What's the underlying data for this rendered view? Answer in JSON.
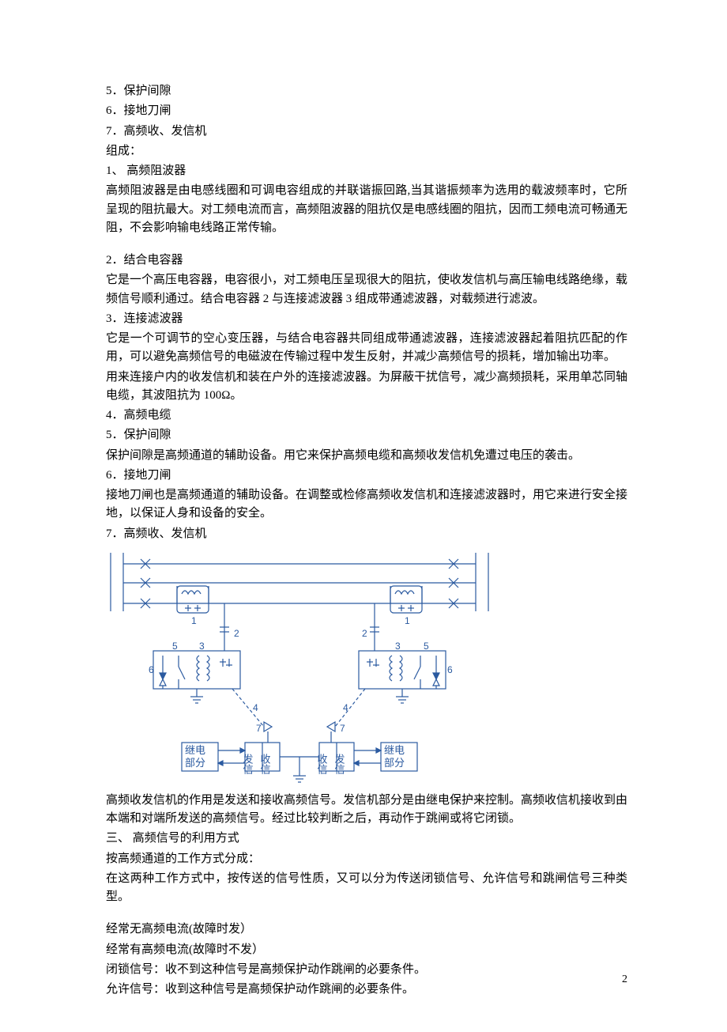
{
  "lines": {
    "l1": "5．保护间隙",
    "l2": "6．接地刀闸",
    "l3": "7．高频收、发信机",
    "l4": "组成：",
    "l5": "1、 高频阻波器",
    "l6": "高频阻波器是由电感线圈和可调电容组成的并联谐振回路,当其谐振频率为选用的载波频率时，它所呈现的阻抗最大。对工频电流而言，高频阻波器的阻抗仅是电感线圈的阻抗，因而工频电流可畅通无阻，不会影响输电线路正常传输。",
    "l7": "2．结合电容器",
    "l8": "它是一个高压电容器，电容很小，对工频电压呈现很大的阻抗，使收发信机与高压输电线路绝缘，载频信号顺利通过。结合电容器 2 与连接滤波器 3 组成带通滤波器，对载频进行滤波。",
    "l9": "3．连接滤波器",
    "l10": "它是一个可调节的空心变压器，与结合电容器共同组成带通滤波器，连接滤波器起着阻抗匹配的作用，可以避免高频信号的电磁波在传输过程中发生反射，并减少高频信号的损耗，增加输出功率。",
    "l11": "用来连接户内的收发信机和装在户外的连接滤波器。为屏蔽干扰信号，减少高频损耗，采用单芯同轴电缆，其波阻抗为 100Ω。",
    "l12": "4．高频电缆",
    "l13": "5．保护间隙",
    "l14": "保护间隙是高频通道的辅助设备。用它来保护高频电缆和高频收发信机免遭过电压的袭击。",
    "l15": "6．接地刀闸",
    "l16": "接地刀闸也是高频通道的辅助设备。在调整或检修高频收发信机和连接滤波器时，用它来进行安全接地，以保证人身和设备的安全。",
    "l17": "7．高频收、发信机",
    "l18": "高频收发信机的作用是发送和接收高频信号。发信机部分是由继电保护来控制。高频收信机接收到由本端和对端所发送的高频信号。经过比较判断之后，再动作于跳闸或将它闭锁。",
    "l19": "三、 高频信号的利用方式",
    "l20": "按高频通道的工作方式分成：",
    "l21": "在这两种工作方式中，按传送的信号性质，又可以分为传送闭锁信号、允许信号和跳闸信号三种类型。",
    "l22": "经常无高频电流(故障时发）",
    "l23": "经常有高频电流(故障时不发）",
    "l24": "闭锁信号：收不到这种信号是高频保护动作跳闸的必要条件。",
    "l25": "允许信号：收到这种信号是高频保护动作跳闸的必要条件。"
  },
  "figure": {
    "numbers": {
      "n1": "1",
      "n2": "2",
      "n3": "3",
      "n4": "4",
      "n5": "5",
      "n6": "6",
      "n7": "7"
    },
    "boxes": {
      "relayL1": "继电",
      "relayL2": "部分",
      "faxin": "发信",
      "shouxin": "收信"
    }
  },
  "pageNumber": "2"
}
